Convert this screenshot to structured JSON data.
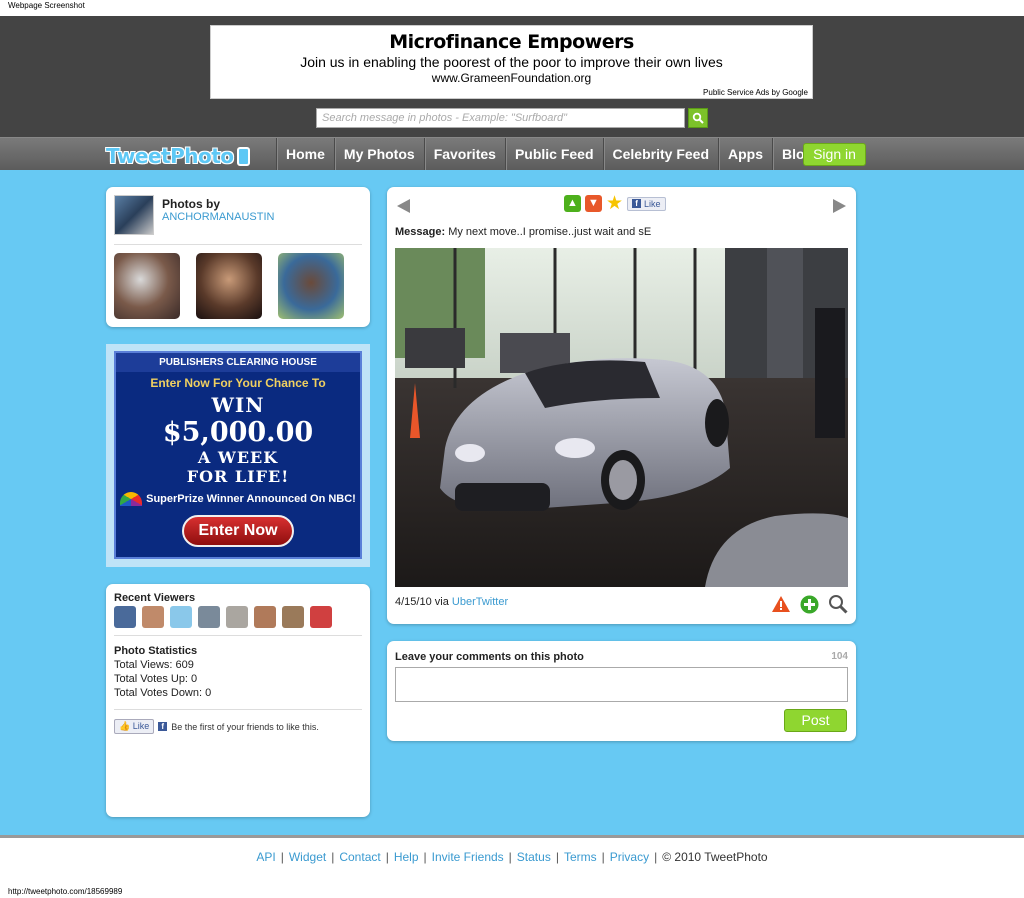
{
  "window": {
    "caption": "Webpage Screenshot",
    "status_url": "http://tweetphoto.com/18569989"
  },
  "header_ad": {
    "title": "Microfinance Empowers",
    "line": "Join us in enabling the poorest of the poor to improve their own lives",
    "url": "www.GrameenFoundation.org",
    "credit": "Public Service Ads by Google"
  },
  "search": {
    "placeholder": "Search message in photos - Example: \"Surfboard\""
  },
  "nav": {
    "logo": "TweetPhoto",
    "items": [
      "Home",
      "My Photos",
      "Favorites",
      "Public Feed",
      "Celebrity Feed",
      "Apps",
      "Blog"
    ],
    "signin": "Sign in"
  },
  "owner": {
    "label": "Photos by",
    "name": "ANCHORMANAUSTIN"
  },
  "pch_ad": {
    "top": "PUBLISHERS CLEARING HOUSE",
    "sub": "Enter Now For Your Chance To",
    "win": "WIN",
    "amount": "$5,000.00",
    "week": "A WEEK",
    "life": "FOR LIFE!",
    "nbc": "SuperPrize Winner Announced On NBC!",
    "button": "Enter Now"
  },
  "stats": {
    "recent_viewers": "Recent Viewers",
    "photo_statistics": "Photo Statistics",
    "total_views": "Total Views: 609",
    "votes_up": "Total Votes Up: 0",
    "votes_down": "Total Votes Down: 0",
    "like": "Like",
    "like_text": "Be the first of your friends to like this."
  },
  "photo": {
    "like": "Like",
    "message_label": "Message:",
    "message": "My next move..I promise..just wait and sE",
    "date_via": "4/15/10 via",
    "source": "UberTwitter"
  },
  "comments": {
    "title": "Leave your comments on this photo",
    "count": "104",
    "post": "Post"
  },
  "footer": {
    "links": [
      "API",
      "Widget",
      "Contact",
      "Help",
      "Invite Friends",
      "Status",
      "Terms",
      "Privacy"
    ],
    "copyright": "© 2010 TweetPhoto"
  },
  "colors": {
    "accent_green": "#8fd630",
    "page_blue": "#67c9f3",
    "link_blue": "#3a9ad0",
    "header_dark": "#444444"
  }
}
